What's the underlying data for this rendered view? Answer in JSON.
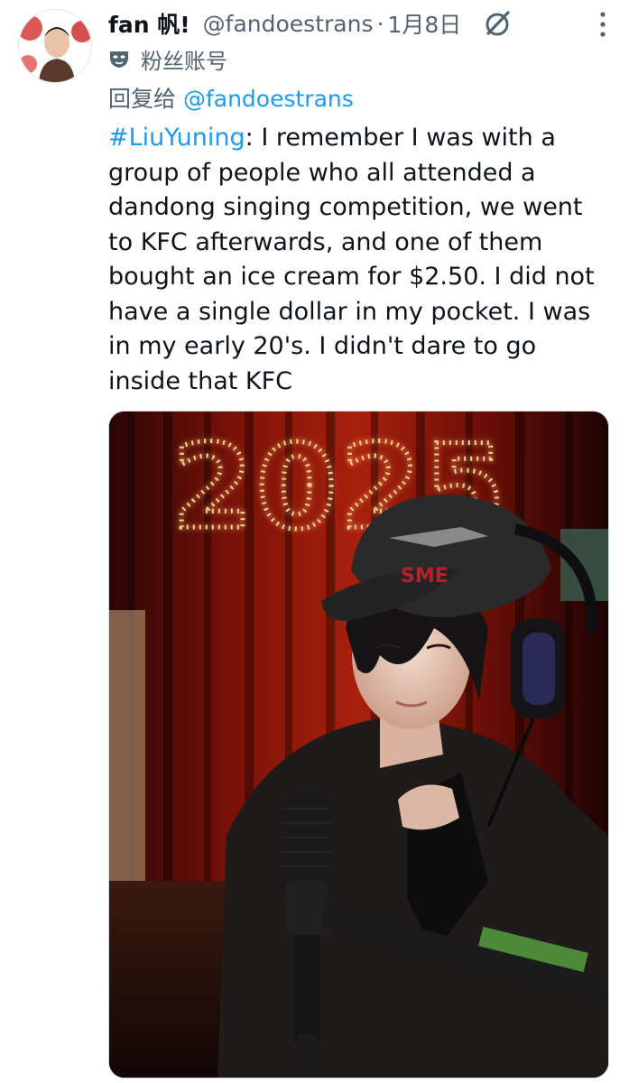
{
  "tweet": {
    "display_name": "fan 帆!",
    "handle": "@fandoestrans",
    "separator": "·",
    "date": "1月8日",
    "account_label": "粉丝账号",
    "reply_prefix": "回复给",
    "reply_mention": "@fandoestrans",
    "hashtag": "#LiuYuning",
    "body": ": I remember I was with a group of people who all attended a dandong singing competition, we went to KFC afterwards, and one of them bought an ice cream for $2.50. I did not have a single dollar in my pocket. I was in my early 20's. I didn't dare to go inside that KFC"
  },
  "media": {
    "sparkler_text": "2025",
    "cap_text": "SME"
  },
  "icons": {
    "grok": "grok-icon",
    "more": "more-vertical-icon",
    "label": "mask-icon"
  },
  "colors": {
    "link": "#1d9bf0",
    "secondary_text": "#536471",
    "primary_text": "#0f1419"
  }
}
